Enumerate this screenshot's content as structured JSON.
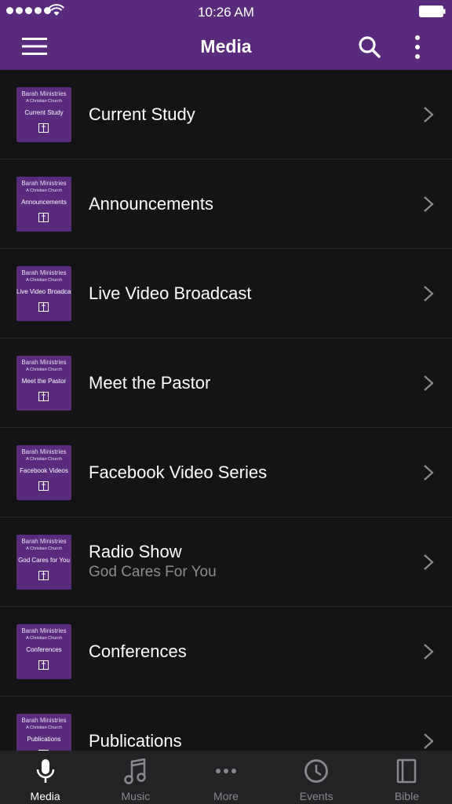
{
  "status_bar": {
    "time": "10:26 AM"
  },
  "header": {
    "title": "Media"
  },
  "items": [
    {
      "label": "Current Study",
      "subtitle": "",
      "thumb": {
        "line1": "Barah Ministries",
        "line2": "A Christian Church",
        "line3": "Current Study"
      }
    },
    {
      "label": "Announcements",
      "subtitle": "",
      "thumb": {
        "line1": "Barah Ministries",
        "line2": "A Christian Church",
        "line3": "Announcements"
      }
    },
    {
      "label": "Live Video Broadcast",
      "subtitle": "",
      "thumb": {
        "line1": "Barah Ministries",
        "line2": "A Christian Church",
        "line3": "Live Video Broadcast"
      }
    },
    {
      "label": "Meet the Pastor",
      "subtitle": "",
      "thumb": {
        "line1": "Barah Ministries",
        "line2": "A Christian Church",
        "line3": "Meet the Pastor"
      }
    },
    {
      "label": "Facebook Video Series",
      "subtitle": "",
      "thumb": {
        "line1": "Barah Ministries",
        "line2": "A Christian Church",
        "line3": "Facebook Videos"
      }
    },
    {
      "label": "Radio Show",
      "subtitle": "God Cares For You",
      "thumb": {
        "line1": "Barah Ministries",
        "line2": "A Christian Church",
        "line3": "God Cares for You"
      }
    },
    {
      "label": "Conferences",
      "subtitle": "",
      "thumb": {
        "line1": "Barah Ministries",
        "line2": "A Christian Church",
        "line3": "Conferences"
      }
    },
    {
      "label": "Publications",
      "subtitle": "",
      "thumb": {
        "line1": "Barah Ministries",
        "line2": "A Christian Church",
        "line3": "Publications"
      }
    }
  ],
  "tabs": [
    {
      "label": "Media",
      "icon": "microphone-icon",
      "active": true
    },
    {
      "label": "Music",
      "icon": "music-note-icon",
      "active": false
    },
    {
      "label": "More",
      "icon": "more-dots-icon",
      "active": false
    },
    {
      "label": "Events",
      "icon": "clock-icon",
      "active": false
    },
    {
      "label": "Bible",
      "icon": "book-icon",
      "active": false
    }
  ],
  "colors": {
    "brand": "#5a2a7c",
    "background": "#141416",
    "tabbar": "#232326",
    "subtitle": "#8d8d90"
  }
}
